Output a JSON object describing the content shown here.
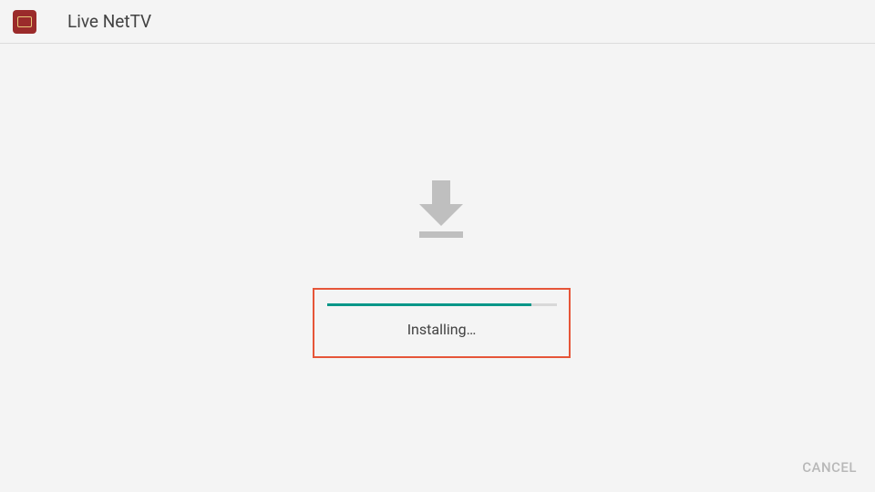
{
  "header": {
    "app_title": "Live NetTV"
  },
  "progress": {
    "status_text": "Installing…",
    "percent": 89
  },
  "actions": {
    "cancel_label": "CANCEL"
  },
  "colors": {
    "accent": "#009688",
    "highlight_border": "#e65538",
    "app_icon_bg": "#9b2b2b"
  }
}
